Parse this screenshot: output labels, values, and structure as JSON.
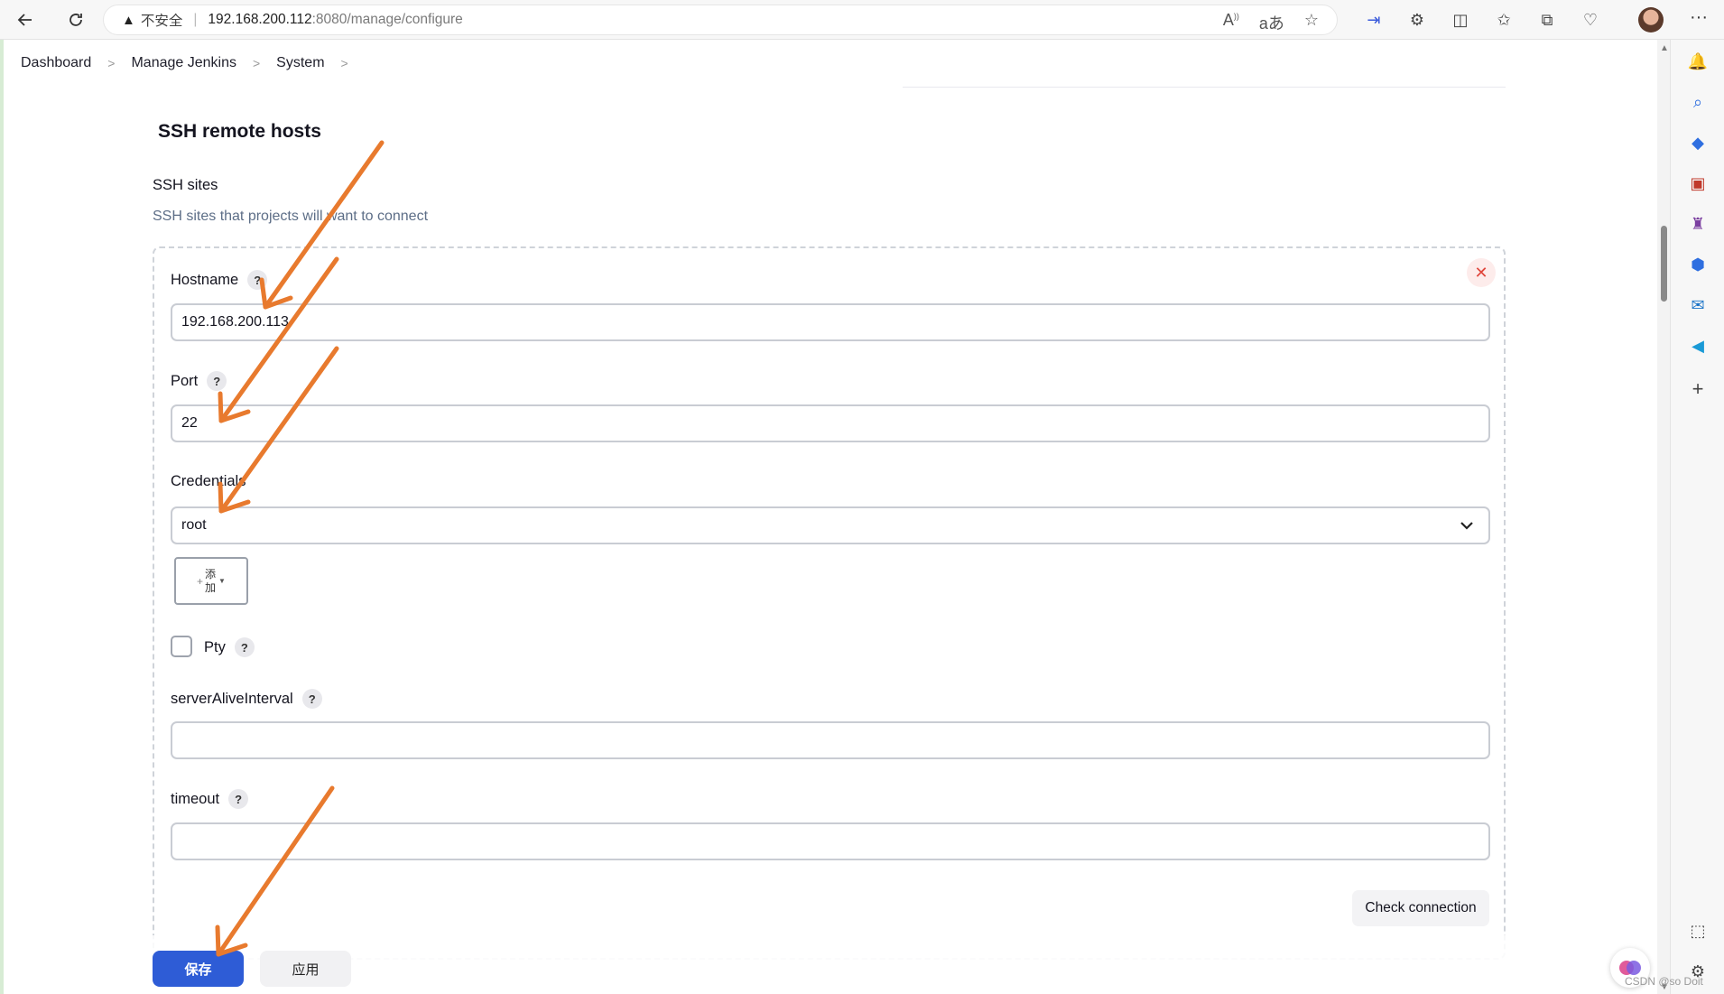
{
  "browser": {
    "insecure_label": "不安全",
    "url_host": "192.168.200.112",
    "url_path": ":8080/manage/configure"
  },
  "breadcrumb": [
    "Dashboard",
    "Manage Jenkins",
    "System"
  ],
  "section": {
    "title": "SSH remote hosts",
    "group_label": "SSH sites",
    "group_desc": "SSH sites that projects will want to connect"
  },
  "form": {
    "hostname_label": "Hostname",
    "hostname_value": "192.168.200.113",
    "port_label": "Port",
    "port_value": "22",
    "credentials_label": "Credentials",
    "credentials_value": "root",
    "add_label_1": "添",
    "add_label_2": "加",
    "pty_label": "Pty",
    "server_alive_label": "serverAliveInterval",
    "server_alive_value": "",
    "timeout_label": "timeout",
    "timeout_value": "",
    "check_connection_label": "Check connection",
    "help_mark": "?"
  },
  "actions": {
    "save_label": "保存",
    "apply_label": "应用"
  },
  "watermark": "CSDN @so Doit",
  "colors": {
    "primary": "#2e5cd6",
    "annotation_arrow": "#e87a2e",
    "close": "#e0453b"
  }
}
